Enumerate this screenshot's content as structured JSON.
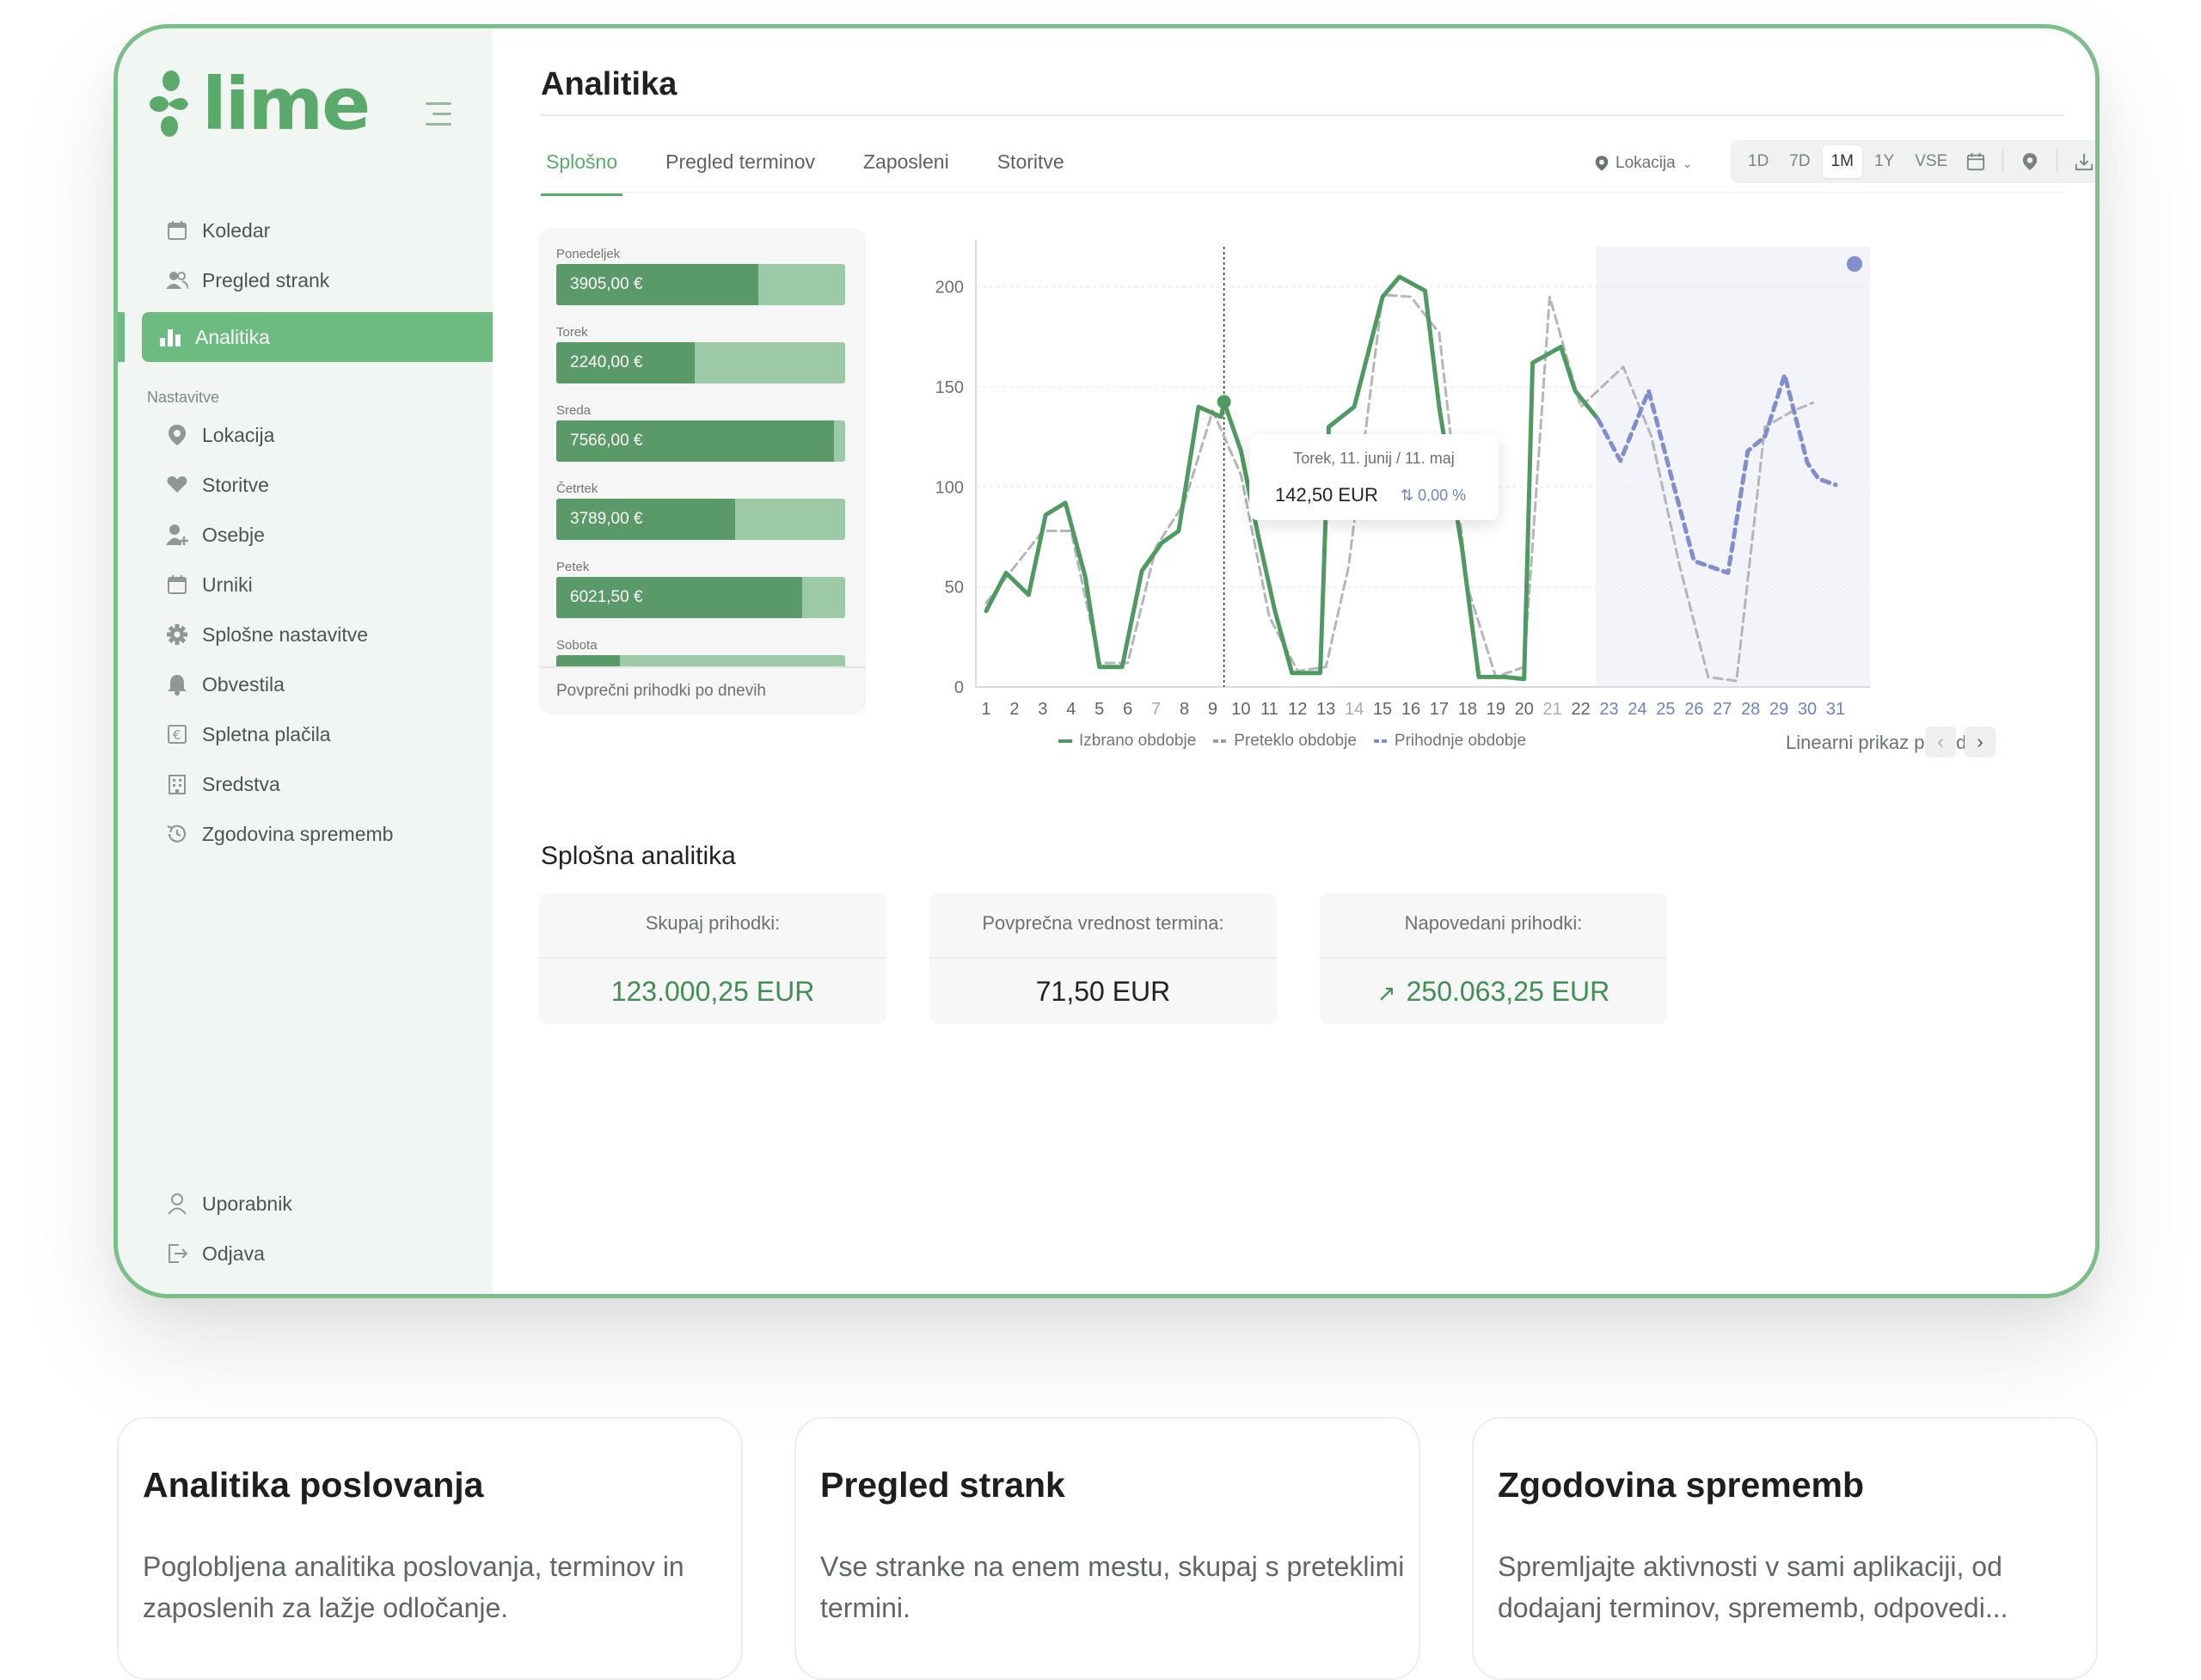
{
  "brand": {
    "name": "lime",
    "color": "#5aaa6c"
  },
  "sidebar": {
    "items": [
      {
        "label": "Koledar",
        "icon": "calendar-icon"
      },
      {
        "label": "Pregled strank",
        "icon": "users-icon"
      },
      {
        "label": "Analitika",
        "icon": "bar-chart-icon",
        "active": true
      }
    ],
    "section_label": "Nastavitve",
    "settings_items": [
      {
        "label": "Lokacija",
        "icon": "location-pin-icon"
      },
      {
        "label": "Storitve",
        "icon": "heart-hand-icon"
      },
      {
        "label": "Osebje",
        "icon": "user-add-icon"
      },
      {
        "label": "Urniki",
        "icon": "calendar-icon"
      },
      {
        "label": "Splošne nastavitve",
        "icon": "gear-icon"
      },
      {
        "label": "Obvestila",
        "icon": "bell-icon"
      },
      {
        "label": "Spletna plačila",
        "icon": "euro-icon"
      },
      {
        "label": "Sredstva",
        "icon": "building-icon"
      },
      {
        "label": "Zgodovina sprememb",
        "icon": "history-icon"
      }
    ],
    "bottom_items": [
      {
        "label": "Uporabnik",
        "icon": "user-icon"
      },
      {
        "label": "Odjava",
        "icon": "logout-icon"
      }
    ]
  },
  "page": {
    "title": "Analitika"
  },
  "tabs": [
    {
      "label": "Splošno",
      "active": true
    },
    {
      "label": "Pregled terminov"
    },
    {
      "label": "Zaposleni"
    },
    {
      "label": "Storitve"
    }
  ],
  "filters": {
    "location_label": "Lokacija",
    "ranges": [
      "1D",
      "7D",
      "1M",
      "1Y",
      "VSE"
    ],
    "active_range": "1M"
  },
  "day_bars": {
    "days": [
      {
        "day": "Ponedeljek",
        "value": "3905,00 €",
        "fraction": 0.7
      },
      {
        "day": "Torek",
        "value": "2240,00 €",
        "fraction": 0.48
      },
      {
        "day": "Sreda",
        "value": "7566,00 €",
        "fraction": 0.96
      },
      {
        "day": "Četrtek",
        "value": "3789,00 €",
        "fraction": 0.62
      },
      {
        "day": "Petek",
        "value": "6021,50 €",
        "fraction": 0.85
      },
      {
        "day": "Sobota",
        "value": "",
        "fraction": 0.22
      }
    ],
    "footer": "Povprečni prihodki po dnevih"
  },
  "chart_data": {
    "type": "line",
    "x": [
      1,
      2,
      3,
      4,
      5,
      6,
      7,
      8,
      9,
      10,
      11,
      12,
      13,
      14,
      15,
      16,
      17,
      18,
      19,
      20,
      21,
      22,
      23,
      24,
      25,
      26,
      27,
      28,
      29,
      30,
      31
    ],
    "ylim": [
      0,
      220
    ],
    "yticks": [
      0,
      50,
      100,
      150,
      200
    ],
    "forecast_from": 22,
    "series": [
      {
        "name": "Izbrano obdobje",
        "color": "#4f9a60",
        "style": "solid",
        "points": [
          [
            1,
            38
          ],
          [
            1.7,
            57
          ],
          [
            2.5,
            46
          ],
          [
            3.1,
            86
          ],
          [
            3.8,
            92
          ],
          [
            4.5,
            55
          ],
          [
            5,
            10
          ],
          [
            5.8,
            10
          ],
          [
            6.5,
            58
          ],
          [
            7.2,
            72
          ],
          [
            7.8,
            78
          ],
          [
            8.5,
            140
          ],
          [
            9.3,
            135
          ],
          [
            9.4,
            142.5
          ],
          [
            10,
            118
          ],
          [
            10.6,
            76
          ],
          [
            11.2,
            38
          ],
          [
            11.8,
            7
          ],
          [
            12.3,
            7
          ],
          [
            12.8,
            7
          ],
          [
            13.1,
            130
          ],
          [
            14,
            140
          ],
          [
            15,
            195
          ],
          [
            15.6,
            205
          ],
          [
            16.5,
            198
          ],
          [
            17,
            140
          ],
          [
            17.8,
            70
          ],
          [
            18.4,
            5
          ],
          [
            19.3,
            5
          ],
          [
            20,
            4
          ],
          [
            20.3,
            162
          ],
          [
            21.3,
            170
          ],
          [
            21.8,
            148
          ],
          [
            22.6,
            134
          ]
        ]
      },
      {
        "name": "Preteklo obdobje",
        "color": "#b4b7b6",
        "style": "dashed",
        "points": [
          [
            1,
            42
          ],
          [
            2,
            60
          ],
          [
            3,
            78
          ],
          [
            4,
            78
          ],
          [
            5,
            12
          ],
          [
            6,
            12
          ],
          [
            7,
            70
          ],
          [
            8,
            92
          ],
          [
            9,
            138
          ],
          [
            10,
            106
          ],
          [
            11,
            35
          ],
          [
            12,
            8
          ],
          [
            13,
            10
          ],
          [
            13.8,
            60
          ],
          [
            15,
            196
          ],
          [
            16,
            195
          ],
          [
            17,
            177
          ],
          [
            18,
            50
          ],
          [
            19,
            5
          ],
          [
            20,
            10
          ],
          [
            20.9,
            195
          ],
          [
            22,
            140
          ],
          [
            23.5,
            160
          ],
          [
            24.5,
            125
          ],
          [
            25.5,
            60
          ],
          [
            26.5,
            5
          ],
          [
            27.5,
            3
          ],
          [
            28.5,
            130
          ],
          [
            29.5,
            138
          ],
          [
            30.2,
            142
          ]
        ]
      },
      {
        "name": "Prihodnje obdobje",
        "color": "#7f8ecc",
        "style": "dotted",
        "points": [
          [
            22.6,
            134
          ],
          [
            23.4,
            113
          ],
          [
            24.4,
            148
          ],
          [
            25.2,
            105
          ],
          [
            26,
            63
          ],
          [
            26.6,
            60
          ],
          [
            27.2,
            57
          ],
          [
            27.9,
            118
          ],
          [
            28.5,
            125
          ],
          [
            29.2,
            156
          ],
          [
            30,
            112
          ],
          [
            30.4,
            104
          ],
          [
            31,
            101
          ]
        ]
      }
    ],
    "highlight": {
      "x": 9.4,
      "y": 142.5
    }
  },
  "tooltip": {
    "date": "Torek, 11. junij / 11. maj",
    "value": "142,50 EUR",
    "change": "0,00 %"
  },
  "legend": {
    "selected": "Izbrano obdobje",
    "past": "Preteklo obdobje",
    "future": "Prihodnje obdobje"
  },
  "chart_mode_label": "Linearni prikaz prihodkov",
  "general_analytics": {
    "title": "Splošna analitika",
    "cards": [
      {
        "label": "Skupaj prihodki:",
        "value": "123.000,25 EUR"
      },
      {
        "label": "Povprečna vrednost termina:",
        "value": "71,50 EUR"
      },
      {
        "label": "Napovedani prihodki:",
        "value": "250.063,25 EUR"
      }
    ]
  },
  "features": [
    {
      "title": "Analitika poslovanja",
      "text": "Poglobljena analitika poslovanja, terminov in zaposlenih za lažje odločanje."
    },
    {
      "title": "Pregled strank",
      "text": "Vse stranke na enem mestu, skupaj s preteklimi termini."
    },
    {
      "title": "Zgodovina sprememb",
      "text": "Spremljajte aktivnosti v sami aplikaciji, od dodajanj terminov, sprememb, odpovedi..."
    }
  ]
}
